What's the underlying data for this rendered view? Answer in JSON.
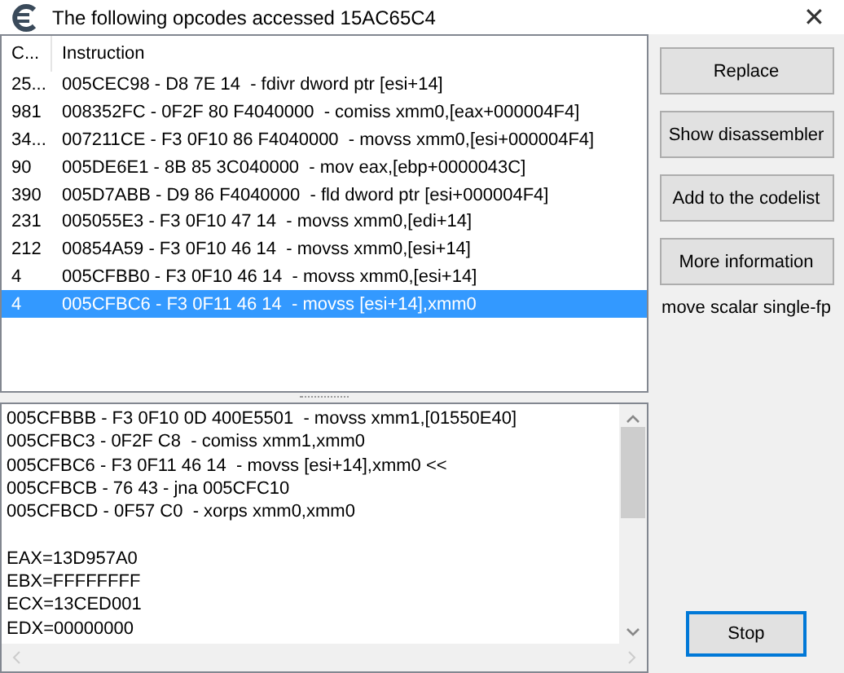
{
  "window": {
    "title": "The following opcodes accessed 15AC65C4",
    "close": "✕"
  },
  "table": {
    "columns": [
      "C...",
      "Instruction"
    ],
    "rows": [
      {
        "count": "25...",
        "instruction": "005CEC98 - D8 7E 14  - fdivr dword ptr [esi+14]",
        "selected": false
      },
      {
        "count": "981",
        "instruction": "008352FC - 0F2F 80 F4040000  - comiss xmm0,[eax+000004F4]",
        "selected": false
      },
      {
        "count": "34...",
        "instruction": "007211CE - F3 0F10 86 F4040000  - movss xmm0,[esi+000004F4]",
        "selected": false
      },
      {
        "count": "90",
        "instruction": "005DE6E1 - 8B 85 3C040000  - mov eax,[ebp+0000043C]",
        "selected": false
      },
      {
        "count": "390",
        "instruction": "005D7ABB - D9 86 F4040000  - fld dword ptr [esi+000004F4]",
        "selected": false
      },
      {
        "count": "231",
        "instruction": "005055E3 - F3 0F10 47 14  - movss xmm0,[edi+14]",
        "selected": false
      },
      {
        "count": "212",
        "instruction": "00854A59 - F3 0F10 46 14  - movss xmm0,[esi+14]",
        "selected": false
      },
      {
        "count": "4",
        "instruction": "005CFBB0 - F3 0F10 46 14  - movss xmm0,[esi+14]",
        "selected": false
      },
      {
        "count": "4",
        "instruction": "005CFBC6 - F3 0F11 46 14  - movss [esi+14],xmm0",
        "selected": true
      }
    ]
  },
  "details": {
    "code_lines": [
      "005CFBBB - F3 0F10 0D 400E5501  - movss xmm1,[01550E40]",
      "005CFBC3 - 0F2F C8  - comiss xmm1,xmm0",
      "005CFBC6 - F3 0F11 46 14  - movss [esi+14],xmm0 <<",
      "005CFBCB - 76 43 - jna 005CFC10",
      "005CFBCD - 0F57 C0  - xorps xmm0,xmm0"
    ],
    "registers": [
      "EAX=13D957A0",
      "EBX=FFFFFFFF",
      "ECX=13CED001",
      "EDX=00000000"
    ]
  },
  "buttons": [
    {
      "label": "Replace"
    },
    {
      "label": "Show disassembler"
    },
    {
      "label": "Add to the codelist"
    },
    {
      "label": "More information"
    }
  ],
  "description": "move scalar single-fp",
  "stop_button": {
    "label": "Stop",
    "default": true
  }
}
